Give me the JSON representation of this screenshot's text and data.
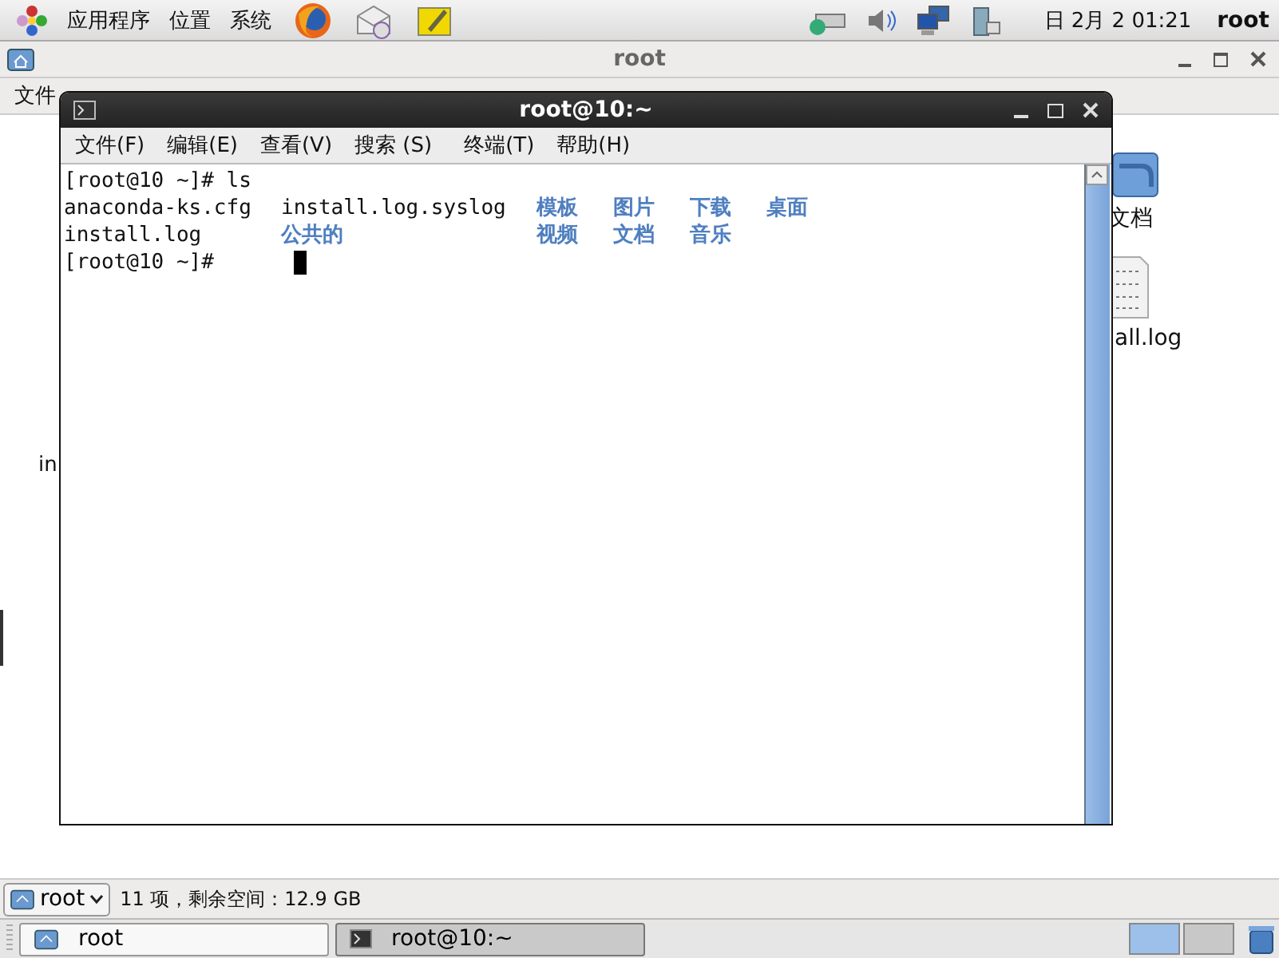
{
  "top_panel": {
    "menus": [
      "应用程序",
      "位置",
      "系统"
    ],
    "clock": "日 2月  2 01:21",
    "user": "root"
  },
  "file_manager": {
    "title": "root",
    "menu": [
      "文件"
    ],
    "items": [
      {
        "label": "in",
        "kind": "text"
      },
      {
        "label": "文档",
        "kind": "folder"
      },
      {
        "label": "all.log",
        "kind": "file"
      }
    ],
    "location": "root",
    "status": "11 项，剩余空间：12.9 GB"
  },
  "terminal": {
    "title": "root@10:~",
    "menu": [
      "文件(F)",
      "编辑(E)",
      "查看(V)",
      "搜索 (S)",
      "终端(T)",
      "帮助(H)"
    ],
    "lines": [
      {
        "cells": [
          {
            "text": "[root@10 ~]# ls",
            "kind": "plain"
          }
        ]
      },
      {
        "cells": [
          {
            "text": "anaconda-ks.cfg",
            "kind": "file"
          },
          {
            "text": "install.log.syslog",
            "kind": "file"
          },
          {
            "text": "模板",
            "kind": "dir"
          },
          {
            "text": "图片",
            "kind": "dir"
          },
          {
            "text": "下载",
            "kind": "dir"
          },
          {
            "text": "桌面",
            "kind": "dir"
          }
        ]
      },
      {
        "cells": [
          {
            "text": "install.log",
            "kind": "file"
          },
          {
            "text": "公共的",
            "kind": "dir"
          },
          {
            "text": "视频",
            "kind": "dir"
          },
          {
            "text": "文档",
            "kind": "dir"
          },
          {
            "text": "音乐",
            "kind": "dir"
          }
        ]
      },
      {
        "cells": [
          {
            "text": "[root@10 ~]#",
            "kind": "plain"
          },
          {
            "kind": "cursor"
          }
        ]
      }
    ]
  },
  "taskbar": [
    {
      "label": "root",
      "kind": "folder",
      "selected": false
    },
    {
      "label": "root@10:~",
      "kind": "terminal",
      "selected": true
    }
  ]
}
